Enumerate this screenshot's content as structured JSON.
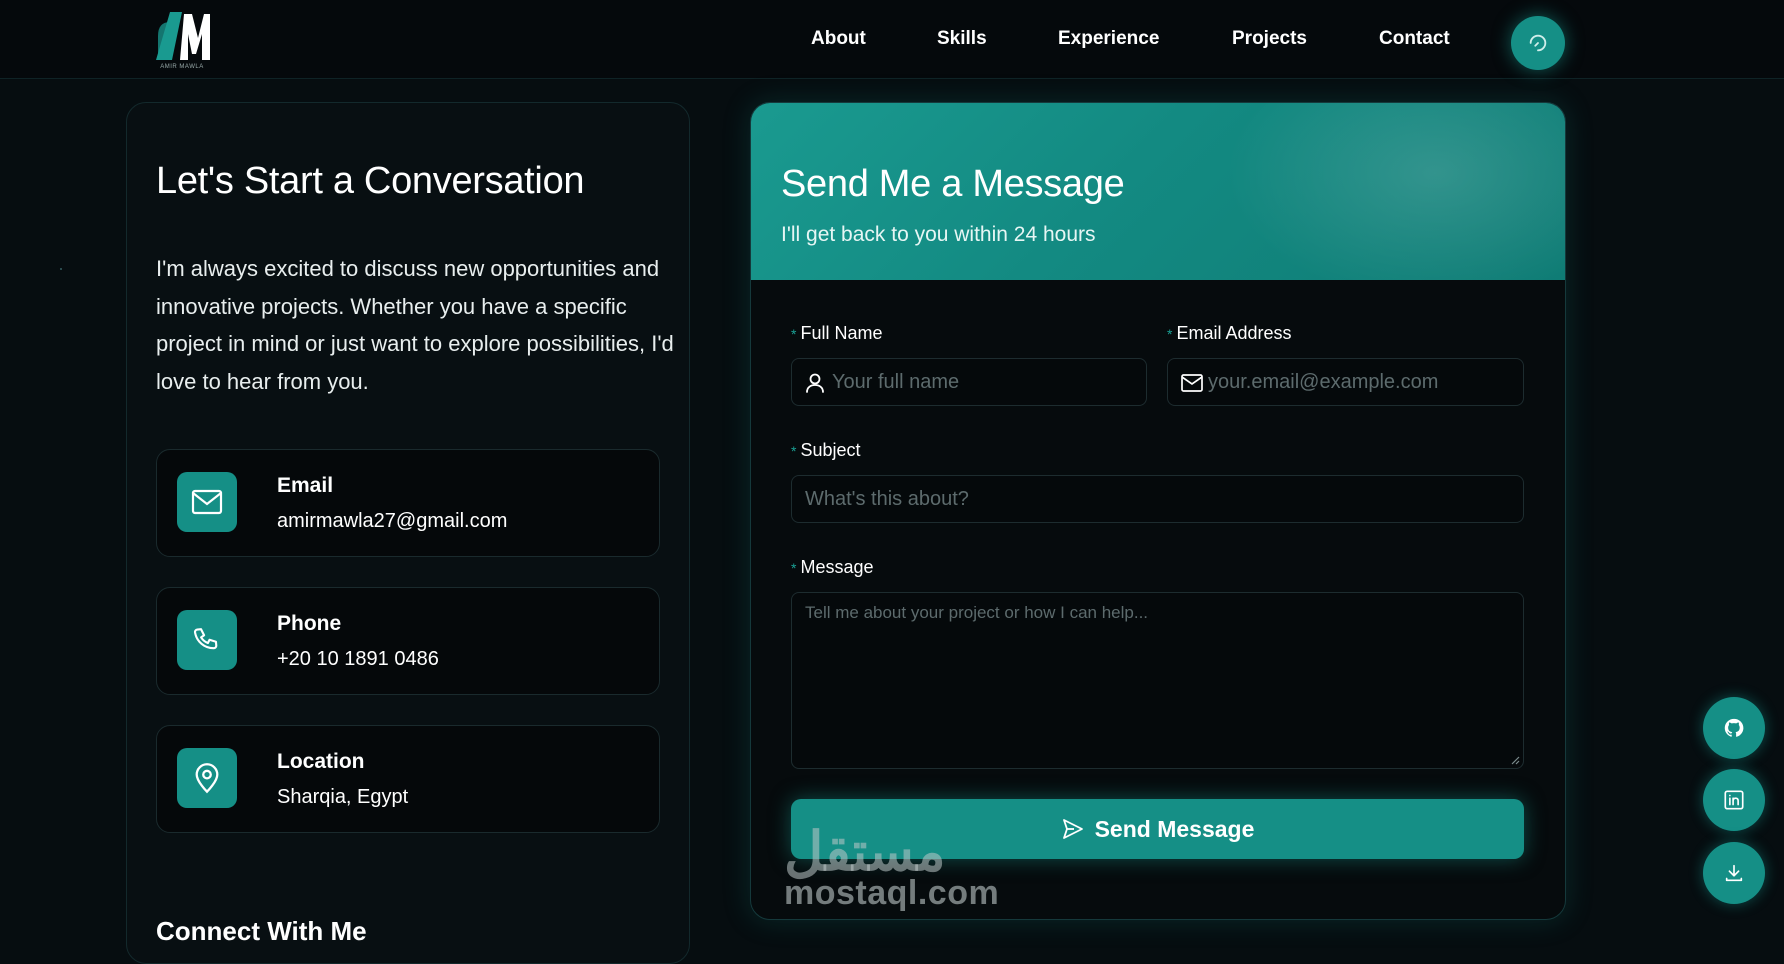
{
  "brand": {
    "logo_letters": "AM",
    "logo_caption": "AMIR MAWLA"
  },
  "nav": {
    "links": [
      "About",
      "Skills",
      "Experience",
      "Projects",
      "Contact"
    ],
    "theme_toggle_icon": "refresh-icon"
  },
  "contact_info": {
    "title": "Let's Start a Conversation",
    "description": "I'm always excited to discuss new opportunities and innovative projects. Whether you have a specific project in mind or just want to explore possibilities, I'd love to hear from you.",
    "items": [
      {
        "label": "Email",
        "value": "amirmawla27@gmail.com",
        "icon": "mail-icon"
      },
      {
        "label": "Phone",
        "value": "+20 10 1891 0486",
        "icon": "phone-icon"
      },
      {
        "label": "Location",
        "value": "Sharqia, Egypt",
        "icon": "map-pin-icon"
      }
    ],
    "connect_title": "Connect With Me"
  },
  "form": {
    "title": "Send Me a Message",
    "subtitle": "I'll get back to you within 24 hours",
    "required_marker": "*",
    "full_name": {
      "label": "Full Name",
      "placeholder": "Your full name"
    },
    "email": {
      "label": "Email Address",
      "placeholder": "your.email@example.com"
    },
    "subject": {
      "label": "Subject",
      "placeholder": "What's this about?"
    },
    "message": {
      "label": "Message",
      "placeholder": "Tell me about your project or how I can help..."
    },
    "submit_label": "Send Message"
  },
  "floating_actions": [
    "github-icon",
    "linkedin-icon",
    "download-icon"
  ],
  "watermark": {
    "arabic": "مستقل",
    "latin": "mostaql.com"
  },
  "colors": {
    "accent": "#158f86",
    "background": "#060d10",
    "card": "#080f12"
  }
}
